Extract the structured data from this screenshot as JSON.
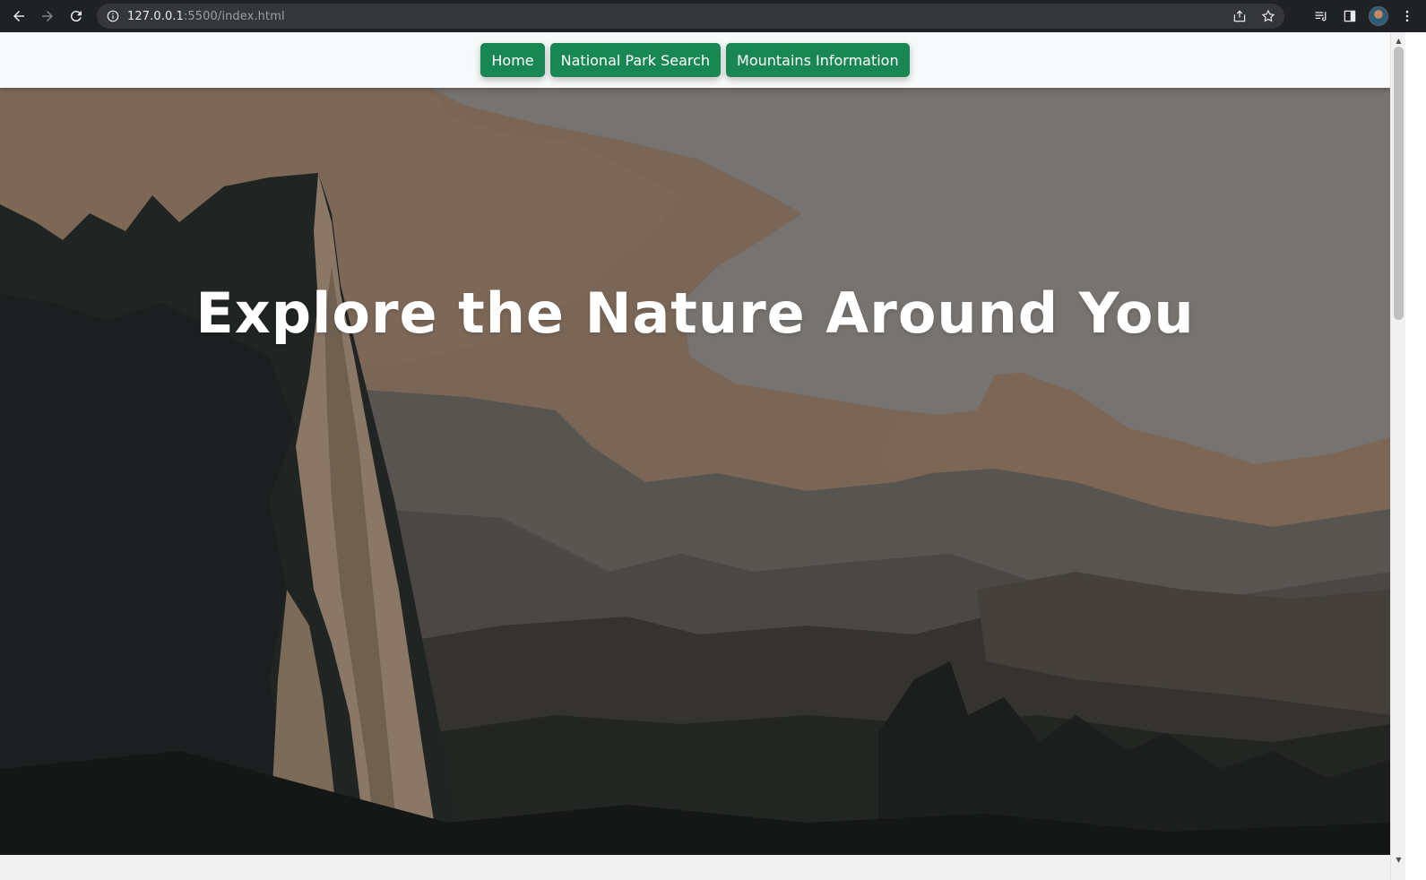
{
  "browser": {
    "url_host": "127.0.0.1",
    "url_rest": ":5500/index.html"
  },
  "navbar": {
    "buttons": [
      {
        "label": "Home"
      },
      {
        "label": "National Park Search"
      },
      {
        "label": "Mountains Information"
      }
    ]
  },
  "hero": {
    "title": "Explore the Nature Around You"
  },
  "icons": {
    "back": "arrow-left-icon",
    "forward": "arrow-right-icon",
    "reload": "reload-icon",
    "info": "info-icon",
    "share": "share-icon",
    "bookmark": "star-icon",
    "reading_list": "reading-list-icon",
    "side_panel": "side-panel-icon",
    "profile": "avatar",
    "menu": "kebab-menu-icon"
  },
  "colors": {
    "accent_button": "#198754",
    "navbar_bg": "#f7f9fa",
    "chrome_bg": "#202124"
  }
}
